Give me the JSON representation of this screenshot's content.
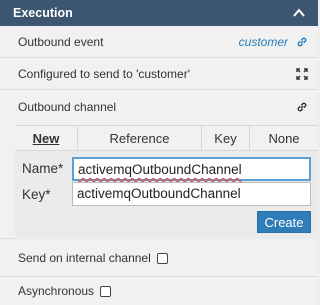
{
  "panel": {
    "title": "Execution"
  },
  "outbound_event": {
    "label": "Outbound event",
    "value": "customer"
  },
  "configured": {
    "text": "Configured to send to 'customer'"
  },
  "outbound_channel": {
    "label": "Outbound channel",
    "tabs": [
      {
        "label": "New",
        "active": true
      },
      {
        "label": "Reference"
      },
      {
        "label": "Key"
      },
      {
        "label": "None"
      }
    ],
    "name_label": "Name*",
    "name_value": "activemqOutboundChannel",
    "key_label": "Key*",
    "key_value": "activemqOutboundChannel",
    "create_label": "Create"
  },
  "send_internal": {
    "label": "Send on internal channel",
    "checked": false
  },
  "asynchronous": {
    "label": "Asynchronous",
    "checked": false
  },
  "colors": {
    "header_bg": "#3c5570",
    "link": "#2a7ab8",
    "button": "#2f7db8"
  }
}
